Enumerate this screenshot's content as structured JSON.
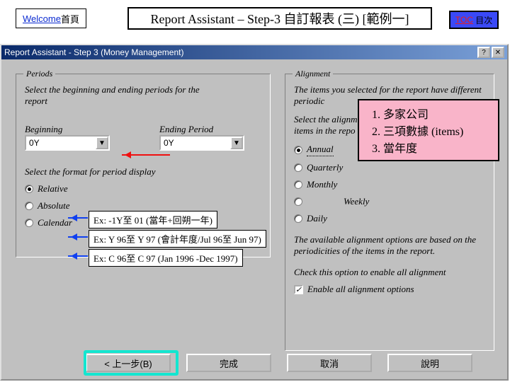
{
  "nav": {
    "welcome_link": "Welcome",
    "welcome_cn": "首頁",
    "main_title": "Report Assistant – Step-3 自訂報表 (三) [範例一]",
    "toc_link": "TOC",
    "toc_cn": "目次"
  },
  "dialog": {
    "title": "Report Assistant - Step 3  (Money Management)",
    "periods": {
      "legend": "Periods",
      "instr": "Select the beginning and ending periods for the report",
      "begin_label": "Beginning",
      "end_label": "Ending Period",
      "begin_value": "0Y",
      "end_value": "0Y",
      "fmt_label": "Select the format for period display",
      "relative": "Relative",
      "absolute": "Absolute",
      "calendar": "Calendar"
    },
    "align": {
      "legend": "Alignment",
      "instr": "The items you selected for the report have different periodic",
      "select_instr": "Select the alignm",
      "select_instr2": "items in the repo",
      "annual": "Annual",
      "quarterly": "Quarterly",
      "monthly": "Monthly",
      "weekly": "Weekly",
      "daily": "Daily",
      "avail": "The available alignment options are based on the periodicities of the items in the report.",
      "check_instr": "Check this option to enable all alignment",
      "enable_all": "Enable all alignment options"
    },
    "buttons": {
      "back": "< 上一步(B)",
      "finish": "完成",
      "cancel": "取消",
      "help": "說明"
    }
  },
  "annotations": {
    "relative": "Ex: -1Y至 01 (當年+回朔一年)",
    "absolute": "Ex: Y 96至 Y 97 (會計年度/Jul 96至 Jun 97)",
    "calendar": "Ex: C 96至 C 97 (Jan 1996 -Dec 1997)"
  },
  "pink": {
    "item1": "多家公司",
    "item2": "三項數據 (items)",
    "item3": "當年度"
  }
}
